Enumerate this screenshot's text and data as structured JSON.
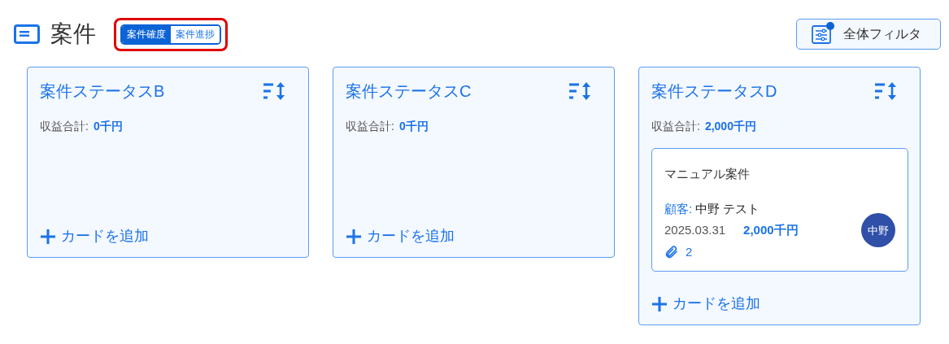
{
  "header": {
    "title": "案件",
    "toggle": {
      "highlighted": true,
      "options": [
        {
          "label": "案件確度",
          "selected": true
        },
        {
          "label": "案件進捗",
          "selected": false
        }
      ]
    },
    "filter_button": {
      "label": "全体フィルタ",
      "active": true
    }
  },
  "columns": [
    {
      "title": "案件ステータスB",
      "revenue_label": "収益合計:",
      "revenue_value": "0千円",
      "add_label": "カードを追加"
    },
    {
      "title": "案件ステータスC",
      "revenue_label": "収益合計:",
      "revenue_value": "0千円",
      "add_label": "カードを追加"
    },
    {
      "title": "案件ステータスD",
      "revenue_label": "収益合計:",
      "revenue_value": "2,000千円",
      "cards": [
        {
          "title": "マニュアル案件",
          "customer_label": "顧客:",
          "customer": "中野 テスト",
          "date": "2025.03.31",
          "amount": "2,000千円",
          "attachments": "2",
          "avatar": "中野"
        }
      ],
      "add_label": "カードを追加"
    }
  ]
}
